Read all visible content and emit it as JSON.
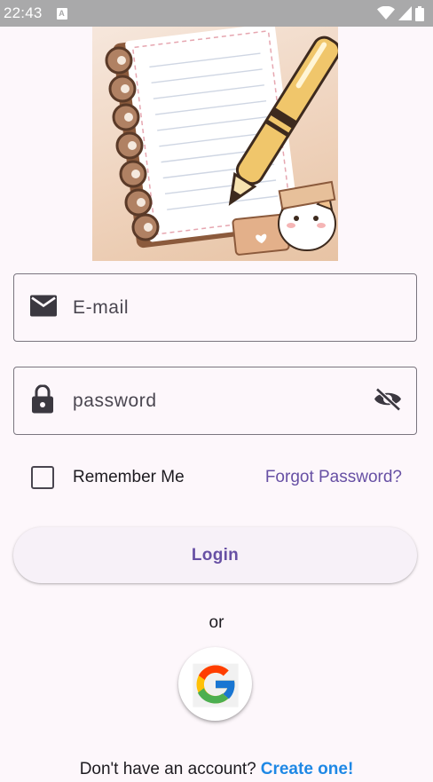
{
  "status_bar": {
    "time": "22:43",
    "a_label": "A"
  },
  "login": {
    "email_placeholder": "E-mail",
    "password_placeholder": "password",
    "remember_label": "Remember Me",
    "forgot_label": "Forgot Password?",
    "login_label": "Login",
    "or_label": "or",
    "signup_prompt": "Don't have an account?",
    "signup_link": "Create one!"
  },
  "colors": {
    "accent": "#6750a4",
    "link": "#1e88e5",
    "background": "#fdf7fb",
    "status_bar": "#a9a9aa"
  },
  "icons": [
    "wifi-icon",
    "signal-icon",
    "battery-icon",
    "email-icon",
    "lock-icon",
    "visibility-off-icon",
    "google-logo-icon"
  ]
}
